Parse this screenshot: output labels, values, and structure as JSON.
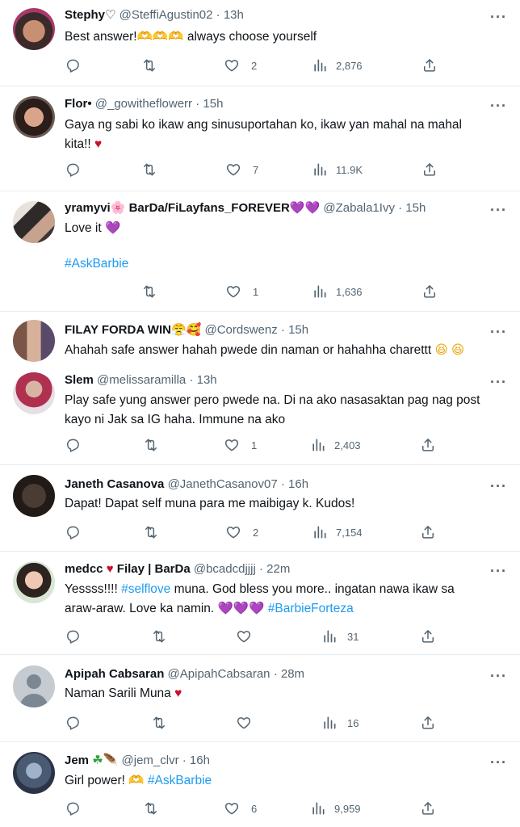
{
  "colors": {
    "link": "#1d9bf0",
    "muted": "#536471",
    "text": "#0f1419",
    "separator": "#e6ebef"
  },
  "tweets": [
    {
      "name": "Stephy",
      "emoji": "♡",
      "handle": "@SteffiAgustin02",
      "time": "· 13h",
      "text_a": "Best answer!",
      "emoji_b": "🫶🫶🫶",
      "text_b": " always choose yourself",
      "stats": {
        "likes": "2",
        "views": "2,876"
      }
    },
    {
      "name": "Flor•",
      "handle": "@_gowitheflowerr",
      "time": "· 15h",
      "line1": "Gaya ng sabi ko ikaw ang sinusuportahan ko, ikaw yan mahal na mahal",
      "line2": "kita!!",
      "emoji": "♥",
      "stats": {
        "likes": "7",
        "views": "11.9K"
      }
    },
    {
      "name": "yramyvi",
      "name_emoji": "🌸",
      "name2": " BarDa/FiLayfans_FOREVER",
      "name_emoji2": "💜💜",
      "handle": "@Zabala1Ivy",
      "time": "· 15h",
      "text": "Love it",
      "emoji": "💜",
      "hashtag": "#AskBarbie",
      "stats": {
        "likes": "1",
        "views": "1,636"
      }
    },
    {
      "name": "FILAY FORDA WIN",
      "name_emoji": "😤🥰",
      "handle": "@Cordswenz",
      "time": "· 15h",
      "text": "Ahahah safe answer hahah pwede din naman or hahahha charettt",
      "emoji": "😆 😆"
    },
    {
      "name": "Slem",
      "handle": "@melissaramilla",
      "time": "· 13h",
      "line1": "Play safe yung answer pero pwede na. Di na ako nasasaktan pag nag post",
      "line2": "kayo ni Jak sa IG haha. Immune na ako",
      "stats": {
        "likes": "1",
        "views": "2,403"
      }
    },
    {
      "name": "Janeth Casanova",
      "handle": "@JanethCasanov07",
      "time": "· 16h",
      "text": "Dapat! Dapat self muna para me maibigay k. Kudos!",
      "stats": {
        "likes": "2",
        "views": "7,154"
      }
    },
    {
      "name": "medcc",
      "name_emoji": "♥",
      "name2": " Filay | BarDa",
      "handle": "@bcadcdjjjj",
      "time": "· 22m",
      "l1_a": "Yessss!!!! ",
      "l1_hash": "#selflove",
      "l1_b": " muna. God bless you more.. ingatan nawa ikaw sa",
      "l2_a": "araw-araw. Love ka namin. ",
      "l2_emoji": "💜💜💜",
      "l2_hash": " #BarbieForteza",
      "stats": {
        "views": "31"
      }
    },
    {
      "name": "Apipah Cabsaran",
      "handle": "@ApipahCabsaran",
      "time": "· 28m",
      "text": "Naman Sarili Muna",
      "emoji": "♥",
      "stats": {
        "views": "16"
      }
    },
    {
      "name": "Jem",
      "name_emoji": "☘",
      "name_emoji2": "🪶",
      "handle": "@jem_clvr",
      "time": "· 16h",
      "text": "Girl power!",
      "emoji": "🫶",
      "hashtag": " #AskBarbie",
      "stats": {
        "likes": "6",
        "views": "9,959"
      }
    }
  ],
  "icons": [
    "reply-icon",
    "retweet-icon",
    "like-icon",
    "views-icon",
    "share-icon",
    "more-icon"
  ]
}
